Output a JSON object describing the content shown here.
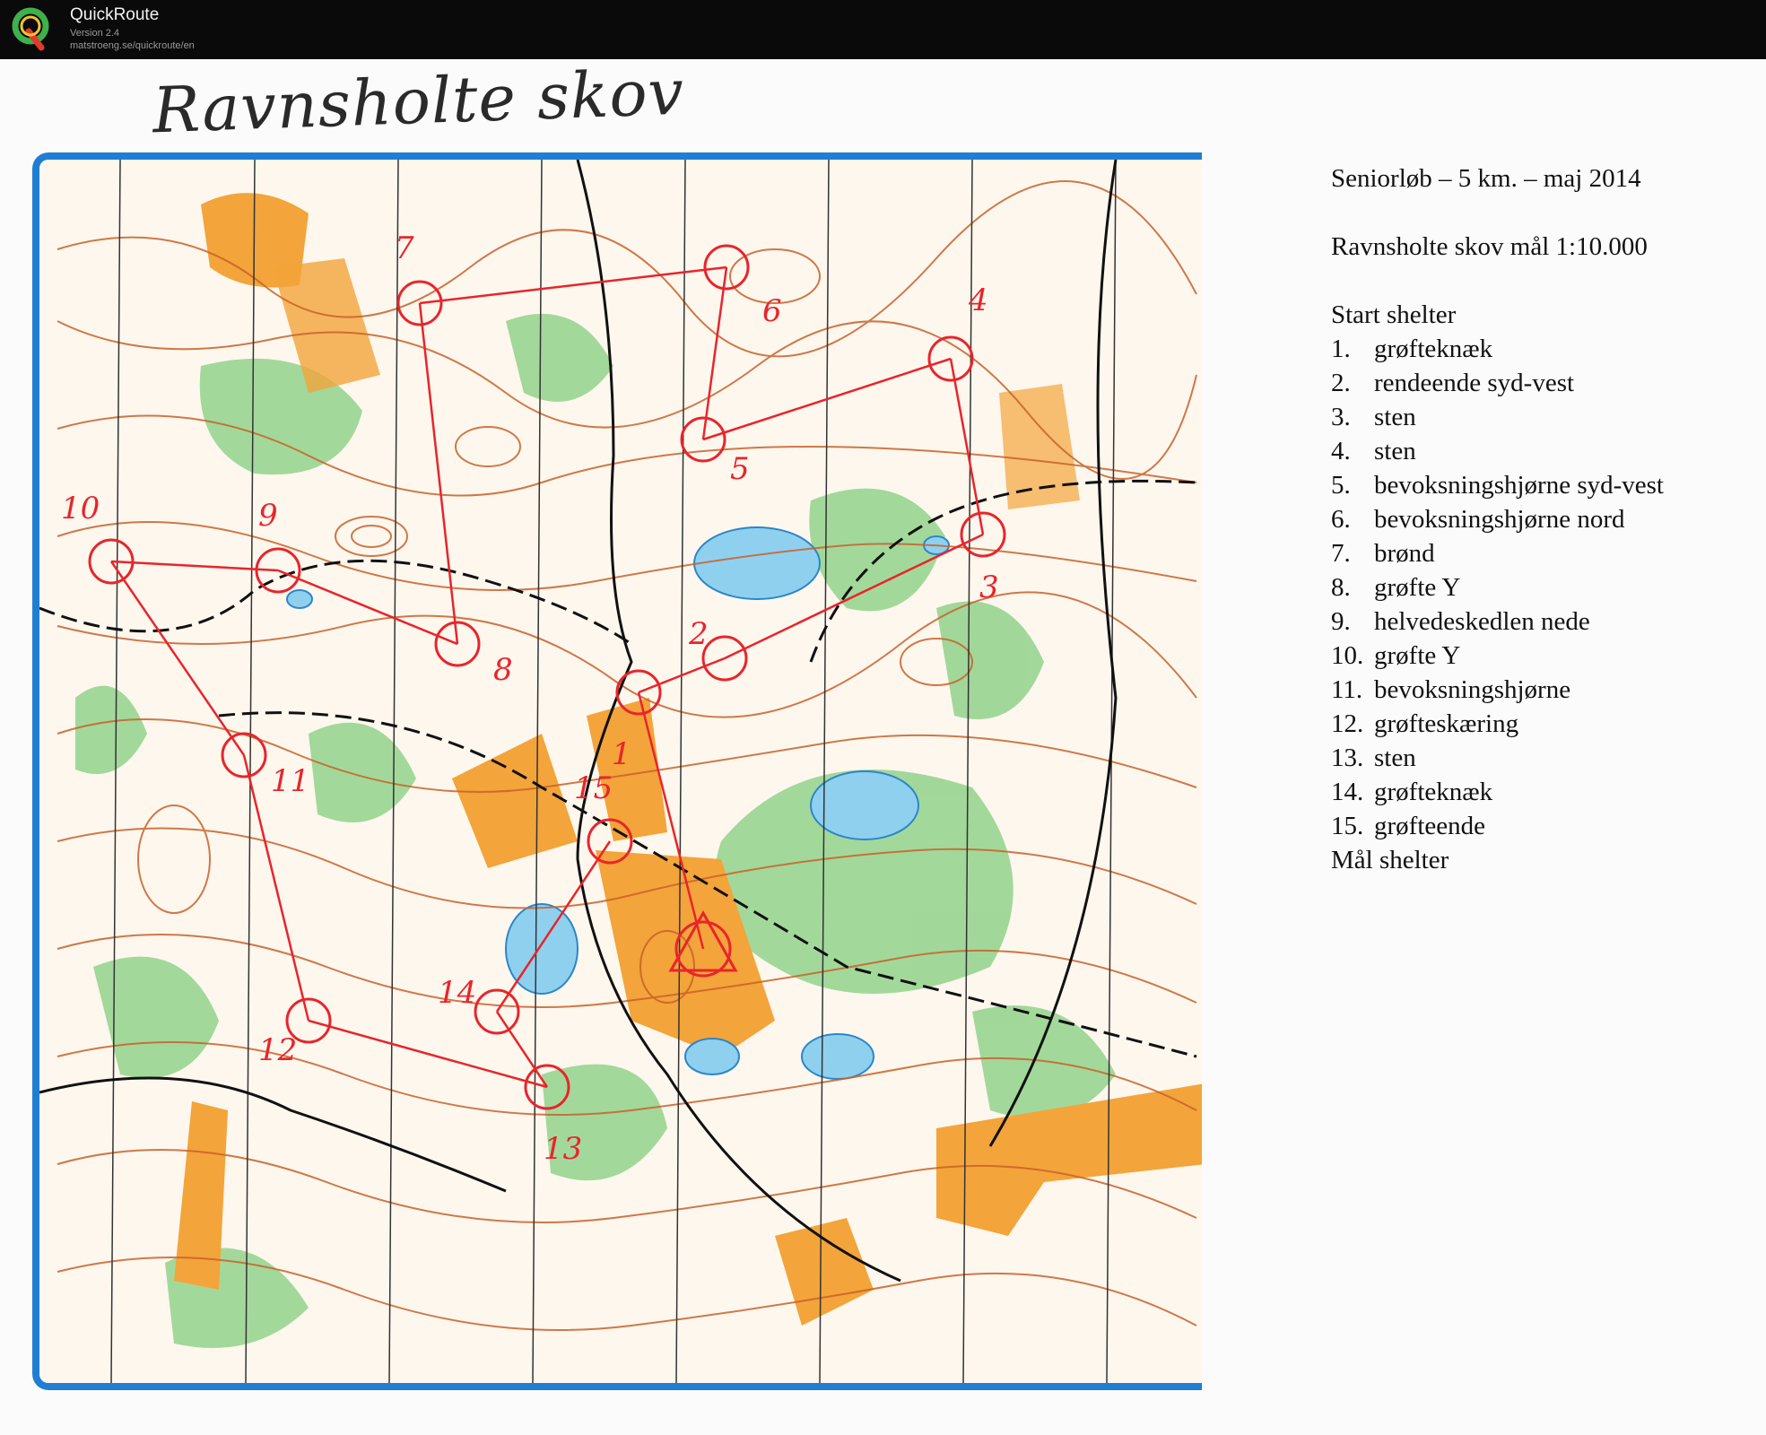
{
  "app": {
    "title": "QuickRoute",
    "version": "Version 2.4",
    "url": "matstroeng.se/quickroute/en"
  },
  "map": {
    "handwritten_title": "Ravnsholte skov",
    "control_numbers": [
      "1",
      "2",
      "3",
      "4",
      "5",
      "6",
      "7",
      "8",
      "9",
      "10",
      "11",
      "12",
      "13",
      "14",
      "15"
    ]
  },
  "course": {
    "heading": "Seniorløb – 5 km. – maj 2014",
    "location": "Ravnsholte skov mål 1:10.000",
    "start": "Start shelter",
    "controls": [
      {
        "num": "1.",
        "desc": "grøfteknæk"
      },
      {
        "num": "2.",
        "desc": "rendeende syd-vest"
      },
      {
        "num": "3.",
        "desc": "sten"
      },
      {
        "num": "4.",
        "desc": "sten"
      },
      {
        "num": "5.",
        "desc": "bevoksningshjørne syd-vest"
      },
      {
        "num": "6.",
        "desc": "bevoksningshjørne nord"
      },
      {
        "num": "7.",
        "desc": "brønd"
      },
      {
        "num": "8.",
        "desc": "grøfte Y"
      },
      {
        "num": "9.",
        "desc": "helvedeskedlen nede"
      },
      {
        "num": "10.",
        "desc": "grøfte Y"
      },
      {
        "num": "11.",
        "desc": "bevoksningshjørne"
      },
      {
        "num": "12.",
        "desc": "grøfteskæring"
      },
      {
        "num": "13.",
        "desc": "sten"
      },
      {
        "num": "14.",
        "desc": "grøfteknæk"
      },
      {
        "num": "15.",
        "desc": "grøfteende"
      }
    ],
    "finish": "Mål shelter"
  },
  "colors": {
    "course_red": "#e8252b",
    "frame_blue": "#1f7ed4",
    "open_orange": "#f3a43a",
    "forest_green": "#7fc77a",
    "water_blue": "#8fd0ef",
    "contour_brown": "#c8622a"
  }
}
